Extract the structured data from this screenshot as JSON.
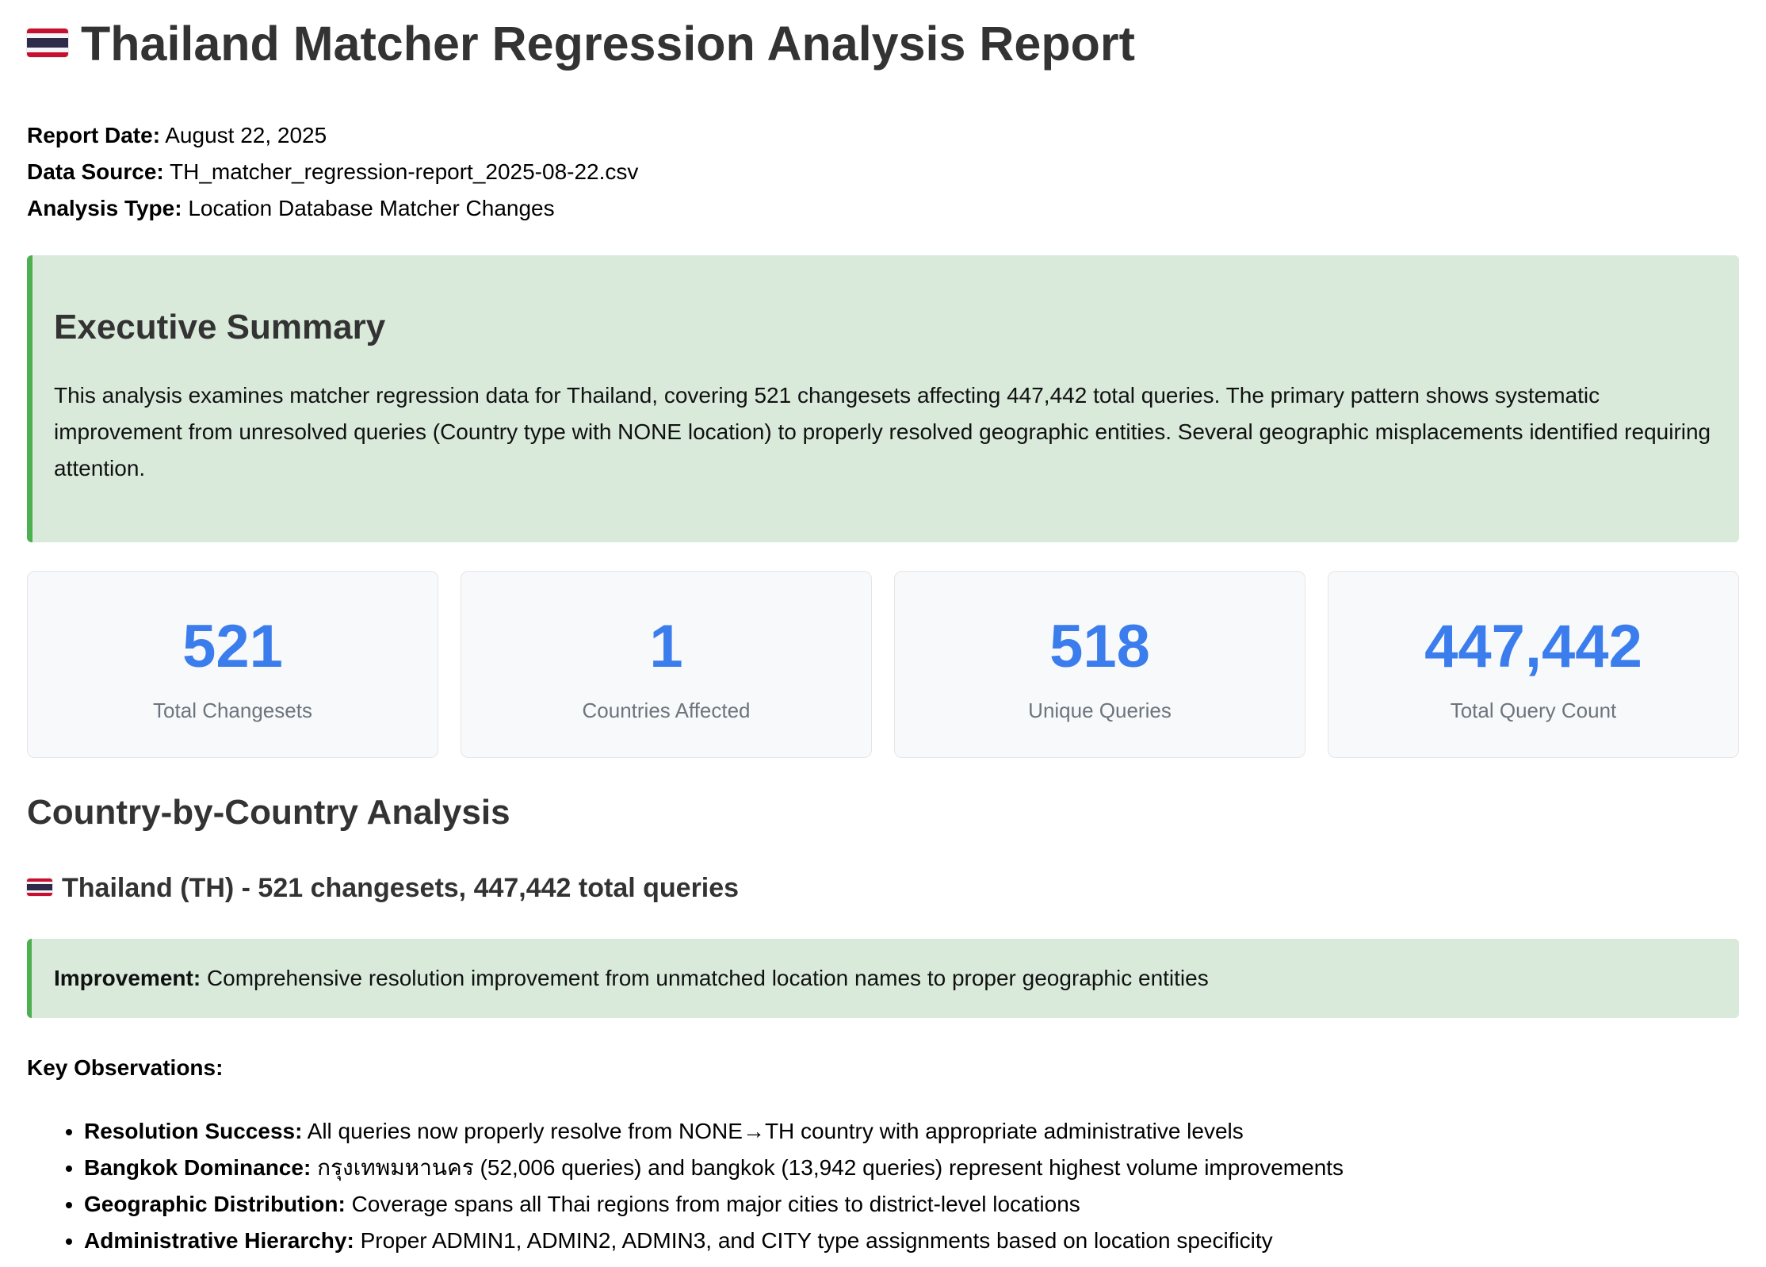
{
  "header": {
    "flag_icon": "thailand-flag-icon",
    "title": "Thailand Matcher Regression Analysis Report"
  },
  "meta": [
    {
      "label": "Report Date:",
      "value": "August 22, 2025"
    },
    {
      "label": "Data Source:",
      "value": "TH_matcher_regression-report_2025-08-22.csv"
    },
    {
      "label": "Analysis Type:",
      "value": "Location Database Matcher Changes"
    }
  ],
  "summary": {
    "title": "Executive Summary",
    "text": "This analysis examines matcher regression data for Thailand, covering 521 changesets affecting 447,442 total queries. The primary pattern shows systematic improvement from unresolved queries (Country type with NONE location) to properly resolved geographic entities. Several geographic misplacements identified requiring attention."
  },
  "stats": [
    {
      "value": "521",
      "label": "Total Changesets"
    },
    {
      "value": "1",
      "label": "Countries Affected"
    },
    {
      "value": "518",
      "label": "Unique Queries"
    },
    {
      "value": "447,442",
      "label": "Total Query Count"
    }
  ],
  "analysis": {
    "section_title": "Country-by-Country Analysis",
    "country_heading": "Thailand (TH) - 521 changesets, 447,442 total queries",
    "callout_label": "Improvement:",
    "callout_text": "Comprehensive resolution improvement from unmatched location names to proper geographic entities",
    "observations_title": "Key Observations:",
    "observations": [
      {
        "label": "Resolution Success:",
        "text": "All queries now properly resolve from NONE→TH country with appropriate administrative levels"
      },
      {
        "label": "Bangkok Dominance:",
        "text": "กรุงเทพมหานคร (52,006 queries) and bangkok (13,942 queries) represent highest volume improvements"
      },
      {
        "label": "Geographic Distribution:",
        "text": "Coverage spans all Thai regions from major cities to district-level locations"
      },
      {
        "label": "Administrative Hierarchy:",
        "text": "Proper ADMIN1, ADMIN2, ADMIN3, and CITY type assignments based on location specificity"
      }
    ]
  },
  "colors": {
    "accent": "#3b7ded",
    "summary_bg": "#d9eadb",
    "summary_border": "#4caf50"
  }
}
